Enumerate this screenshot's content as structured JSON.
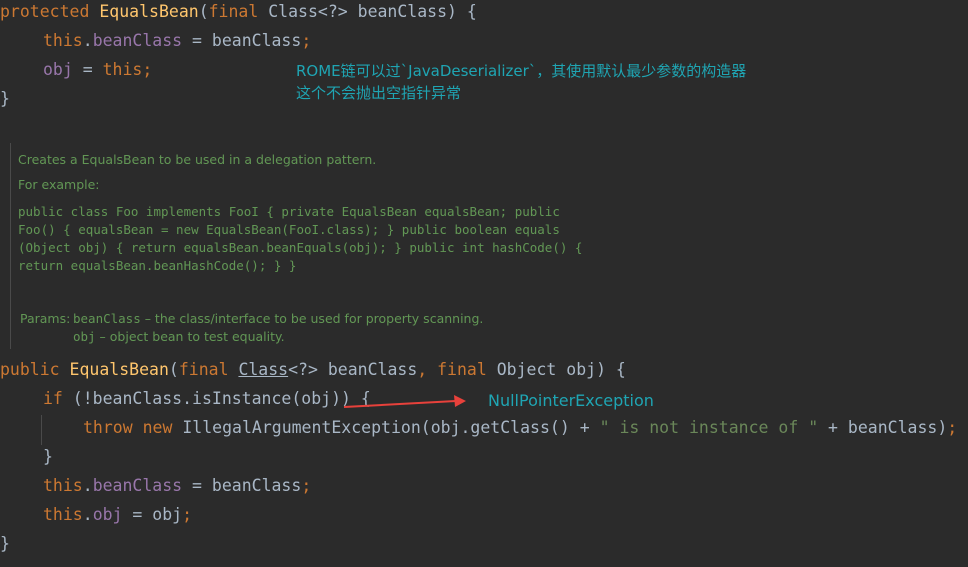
{
  "code_top": {
    "l1": {
      "kw1": "protected",
      "fn": "EqualsBean",
      "p1": "(",
      "kw2": "final",
      "p2": " Class<?> beanClass) {"
    },
    "l2": {
      "kw": "this",
      "p1": ".",
      "fld": "beanClass",
      "p2": " = beanClass",
      "semi": ";"
    },
    "l3": {
      "fld": "obj",
      "p1": " = ",
      "kw": "this",
      "semi": ";"
    },
    "l4": "}"
  },
  "annotation_top": {
    "line1": "ROME链可以过`JavaDeserializer`，其使用默认最少参数的构造器",
    "line2": "这个不会抛出空指针异常"
  },
  "doc": {
    "summary": "Creates a EqualsBean to be used in a delegation pattern.",
    "for_example": "For example:",
    "code_lines": [
      "public class Foo implements FooI { private EqualsBean equalsBean; public",
      "Foo() { equalsBean = new EqualsBean(FooI.class); } public boolean equals",
      "(Object obj) { return equalsBean.beanEquals(obj); } public int hashCode() {",
      "return equalsBean.beanHashCode(); } }"
    ],
    "params_label": "Params:",
    "param1_name": "beanClass",
    "param1_desc": " – the class/interface to be used for property scanning.",
    "param2_name": "obj",
    "param2_desc": " – object bean to test equality."
  },
  "code_bottom": {
    "l1": {
      "kw1": "public",
      "fn": "EqualsBean",
      "p1": "(",
      "kw2": "final",
      "cls": "Class",
      "p2": "<?> beanClass",
      "comma": ",",
      "kw3": "final",
      "p3": " Object obj) {"
    },
    "l2": {
      "kw": "if",
      "p1": " (!beanClass.isInstance(obj)) {"
    },
    "l3": {
      "kw1": "throw",
      "kw2": "new",
      "p1": " IllegalArgumentException(obj.getClass() + ",
      "str": "\" is not instance of \"",
      "p2": " + beanClass)",
      "semi": ";"
    },
    "l4": "}",
    "l5": {
      "kw": "this",
      "p1": ".",
      "fld": "beanClass",
      "p2": " = beanClass",
      "semi": ";"
    },
    "l6": {
      "kw": "this",
      "p1": ".",
      "fld": "obj",
      "p2": " = obj",
      "semi": ";"
    },
    "l7": "}"
  },
  "annotation_npe": "NullPointerException",
  "colors": {
    "background": "#2b2b2b",
    "keyword": "#cc7832",
    "method": "#ffc66d",
    "field": "#9876aa",
    "doc": "#629755",
    "annotation": "#1fa5b3",
    "arrow": "#e8413b"
  }
}
